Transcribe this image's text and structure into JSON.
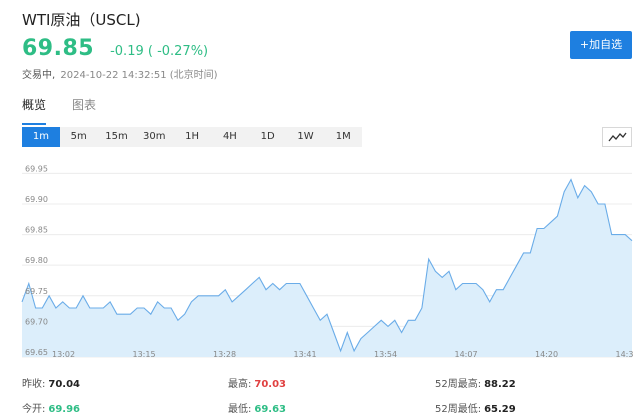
{
  "header": {
    "title": "WTI原油（USCL)",
    "price": "69.85",
    "change": "-0.19 ( -0.27%)",
    "status": "交易中,",
    "timestamp": "2024-10-22 14:32:51 (北京时间)",
    "watchlist_button": "+加自选"
  },
  "tabs": [
    {
      "label": "概览",
      "active": true
    },
    {
      "label": "图表",
      "active": false
    }
  ],
  "periods": [
    "1m",
    "5m",
    "15m",
    "30m",
    "1H",
    "4H",
    "1D",
    "1W",
    "1M"
  ],
  "active_period": "1m",
  "chart_toggle_icon": "line-chart-icon",
  "chart_data": {
    "type": "area",
    "y_ticks": [
      "69.95",
      "69.90",
      "69.85",
      "69.80",
      "69.75",
      "69.70",
      "69.65"
    ],
    "x_ticks": [
      "13:02",
      "13:15",
      "13:28",
      "13:41",
      "13:54",
      "14:07",
      "14:20",
      "14:3"
    ],
    "ylim": [
      69.65,
      69.98
    ],
    "grid": true,
    "line_color": "#6aace8",
    "fill_color": "#dceefb",
    "series": [
      {
        "values": [
          69.74,
          69.77,
          69.73,
          69.73,
          69.75,
          69.73,
          69.74,
          69.73,
          69.73,
          69.75,
          69.73,
          69.73,
          69.73,
          69.74,
          69.72,
          69.72,
          69.72,
          69.73,
          69.73,
          69.72,
          69.74,
          69.73,
          69.73,
          69.71,
          69.72,
          69.74,
          69.75,
          69.75,
          69.75,
          69.75,
          69.76,
          69.74,
          69.75,
          69.76,
          69.77,
          69.78,
          69.76,
          69.77,
          69.76,
          69.77,
          69.77,
          69.77,
          69.75,
          69.73,
          69.71,
          69.72,
          69.69,
          69.66,
          69.69,
          69.66,
          69.68,
          69.69,
          69.7,
          69.71,
          69.7,
          69.71,
          69.69,
          69.71,
          69.71,
          69.73,
          69.81,
          69.79,
          69.78,
          69.79,
          69.76,
          69.77,
          69.77,
          69.77,
          69.76,
          69.74,
          69.76,
          69.76,
          69.78,
          69.8,
          69.82,
          69.82,
          69.86,
          69.86,
          69.87,
          69.88,
          69.92,
          69.94,
          69.91,
          69.93,
          69.92,
          69.9,
          69.9,
          69.85,
          69.85,
          69.85,
          69.84
        ]
      }
    ]
  },
  "stats": [
    {
      "label": "昨收:",
      "value": "70.04",
      "tone": "dark"
    },
    {
      "label": "最高:",
      "value": "70.03",
      "tone": "red"
    },
    {
      "label": "52周最高:",
      "value": "88.22",
      "tone": "dark"
    },
    {
      "label": "今开:",
      "value": "69.96",
      "tone": "green"
    },
    {
      "label": "最低:",
      "value": "69.63",
      "tone": "green"
    },
    {
      "label": "52周最低:",
      "value": "65.29",
      "tone": "dark"
    }
  ]
}
